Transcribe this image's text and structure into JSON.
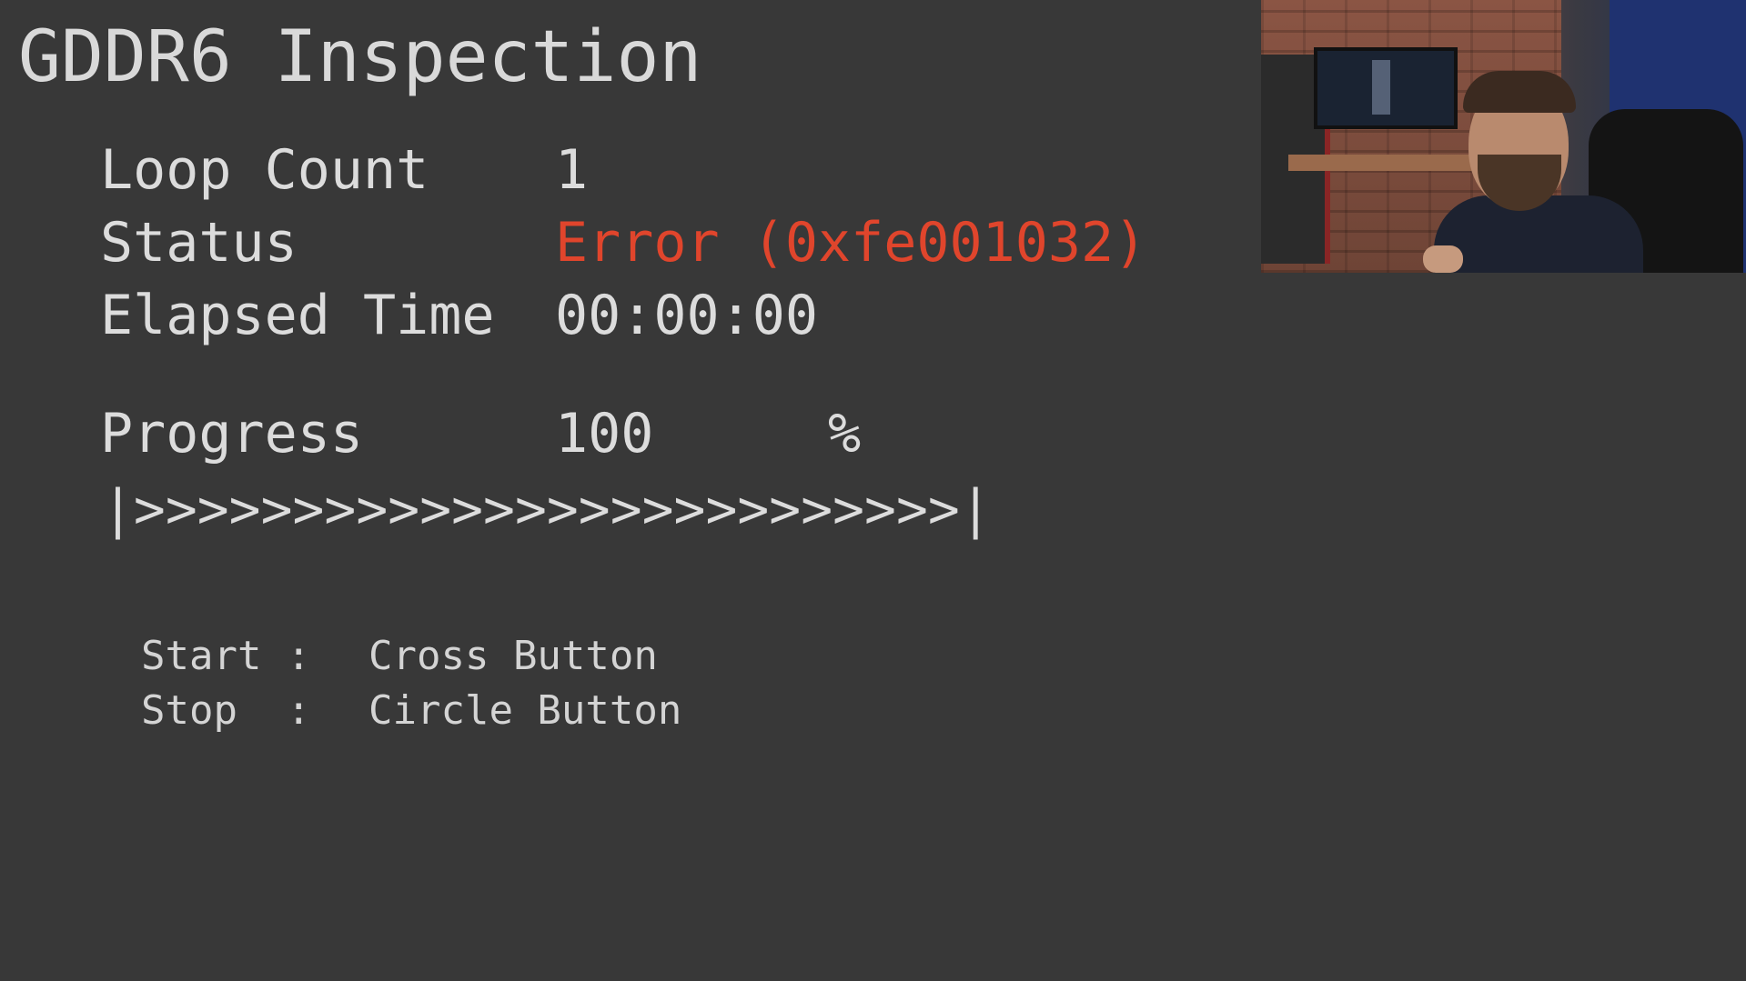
{
  "title": "GDDR6 Inspection",
  "stats": {
    "loop_count": {
      "label": "Loop Count",
      "value": "1"
    },
    "status": {
      "label": "Status",
      "value": "Error (0xfe001032)"
    },
    "elapsed": {
      "label": "Elapsed Time",
      "value": "00:00:00"
    },
    "progress": {
      "label": "Progress",
      "value": "100",
      "unit": "%"
    }
  },
  "progress_bar": "|>>>>>>>>>>>>>>>>>>>>>>>>>>|",
  "controls": {
    "start": {
      "key": "Start",
      "sep": ":",
      "action": "Cross Button"
    },
    "stop": {
      "key": "Stop",
      "sep": ":",
      "action": "Circle Button"
    }
  },
  "colors": {
    "background": "#383838",
    "text": "#dcdcdc",
    "error": "#e0452c"
  }
}
